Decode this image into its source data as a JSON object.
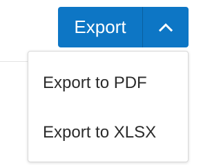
{
  "export_button": {
    "label": "Export",
    "toggle_icon": "chevron-up-icon"
  },
  "export_menu": {
    "items": [
      {
        "label": "Export to PDF"
      },
      {
        "label": "Export to XLSX"
      }
    ]
  },
  "colors": {
    "button_background": "#0d76c5",
    "button_text": "#ffffff",
    "menu_text": "#2b2b2b",
    "menu_border": "#d9d9d9"
  }
}
